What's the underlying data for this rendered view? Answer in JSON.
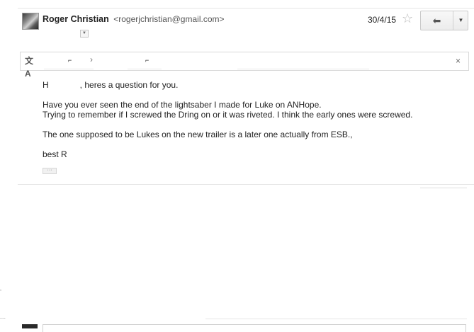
{
  "header": {
    "sender_name": "Roger Christian",
    "sender_email": "<rogerjchristian@gmail.com>",
    "date": "30/4/15",
    "star_icon": "☆",
    "reply_icon": "⬅",
    "more_icon": "▼",
    "details_icon": "▼"
  },
  "translate_bar": {
    "icon": "文A",
    "from_language": "⌐",
    "arrow": "›",
    "to_language": "⌐",
    "close_icon": "×"
  },
  "message": {
    "greeting_start": "H",
    "greeting_rest": ", heres a question for you.",
    "line1": "Have you ever seen the end of the lightsaber I made for Luke on ANHope.",
    "line2": " Trying to remember if I screwed the Dring on or it was riveted.  I think the early ones were screwed.",
    "line3": "The one supposed to be Lukes on the new trailer is a later one actually from ESB.,",
    "signoff": "best R",
    "show_trimmed": "···"
  }
}
